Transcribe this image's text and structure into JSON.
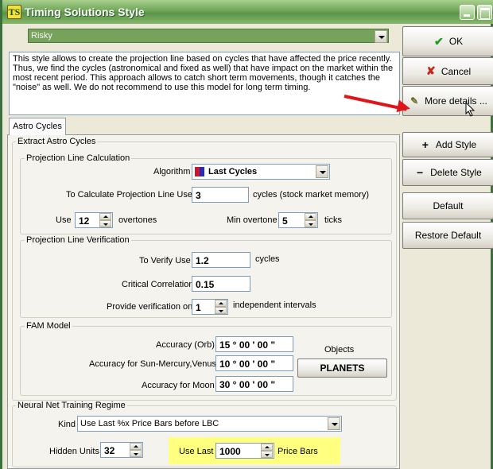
{
  "window": {
    "title": "Timing Solutions Style",
    "icon_text": "TS"
  },
  "style_select": {
    "value": "Risky"
  },
  "description": "This style allows to create the projection line based on cycles that have affected the price recently. Thus, we find the cycles (astronomical and fixed as well) that have impact on the market within the most recent period. This approach allows to catch short term movements, though it catches the \"noise\" as well. We do not recommend to use this model for long term timing.",
  "buttons": {
    "ok": "OK",
    "cancel": "Cancel",
    "more_details": "More details ...",
    "add_style": "Add Style",
    "delete_style": "Delete Style",
    "default": "Default",
    "restore_default": "Restore Default"
  },
  "tab": {
    "label": "Astro Cycles"
  },
  "extract": {
    "title": "Extract Astro Cycles",
    "calc": {
      "title": "Projection Line Calculation",
      "algorithm_label": "Algorithm",
      "algorithm_value": "Last Cycles",
      "to_calc_label": "To Calculate Projection Line Use",
      "to_calc_value": "3",
      "to_calc_unit": "cycles (stock market memory)",
      "use_label": "Use",
      "use_value": "12",
      "use_unit": "overtones",
      "min_overtone_label": "Min overtone",
      "min_overtone_value": "5",
      "min_overtone_unit": "ticks"
    },
    "verify": {
      "title": "Projection Line Verification",
      "to_verify_label": "To Verify Use",
      "to_verify_value": "1.2",
      "to_verify_unit": "cycles",
      "critical_label": "Critical Correlation",
      "critical_value": "0.15",
      "provide_label": "Provide verification on",
      "provide_value": "1",
      "provide_unit": "independent intervals"
    },
    "fam": {
      "title": "FAM Model",
      "accuracy_orb_label": "Accuracy (Orb)",
      "accuracy_orb_value": "15  ° 00 '  00 \"",
      "accuracy_sun_label": "Accuracy for Sun-Mercury,Venus",
      "accuracy_sun_value": "10  ° 00 '  00 \"",
      "accuracy_moon_label": "Accuracy for Moon",
      "accuracy_moon_value": "30  ° 00 '  00 \"",
      "objects_label": "Objects",
      "planets_button": "PLANETS"
    }
  },
  "neural": {
    "title": "Neural Net Training Regime",
    "kind_label": "Kind",
    "kind_value": "Use Last %x Price Bars before LBC",
    "hidden_label": "Hidden Units",
    "hidden_value": "32",
    "use_last_label": "Use Last",
    "use_last_value": "1000",
    "use_last_unit": "Price Bars"
  },
  "colors": {
    "title_green": "#6fa558",
    "style_combo_green": "#76a25b",
    "arrow_red": "#e0151a",
    "highlight_yellow": "#ffff80"
  },
  "icons": {
    "ok": "check-icon",
    "cancel": "x-icon",
    "more_details": "pen-icon",
    "add": "plus-icon",
    "delete": "minus-icon"
  }
}
